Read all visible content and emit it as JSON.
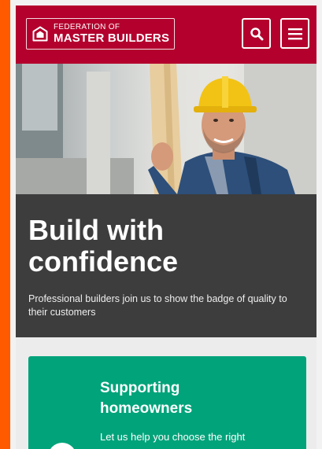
{
  "header": {
    "logo_line1": "FEDERATION OF",
    "logo_line2": "MASTER BUILDERS",
    "icons": {
      "logo": "house-shield-icon",
      "search": "search-icon",
      "menu": "hamburger-menu-icon"
    }
  },
  "hero": {
    "banner_title": "Build with confidence",
    "banner_subtitle": "Professional builders join us to show the badge of quality to their customers"
  },
  "card": {
    "title": "Supporting homeowners",
    "text": "Let us help you choose the right"
  },
  "colors": {
    "brand_red": "#b3002d",
    "banner_dark": "#3d3d3d",
    "card_green": "#00a37a",
    "frame_orange": "#ff5a00"
  }
}
